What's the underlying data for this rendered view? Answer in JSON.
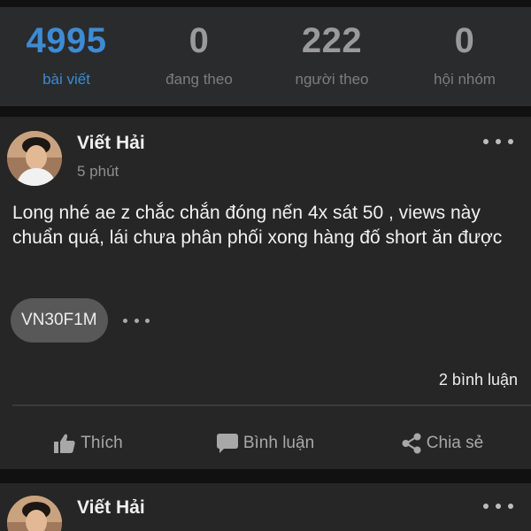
{
  "stats": [
    {
      "value": "4995",
      "label": "bài viết",
      "active": true
    },
    {
      "value": "0",
      "label": "đang theo",
      "active": false
    },
    {
      "value": "222",
      "label": "người theo",
      "active": false
    },
    {
      "value": "0",
      "label": "hội nhóm",
      "active": false
    }
  ],
  "post1": {
    "author": "Viết Hải",
    "time": "5 phút",
    "content": "Long nhé ae z chắc chắn đóng nến 4x sát 50 , views này chuẩn quá, lái chưa phân phối xong hàng đố short ăn được",
    "tag": "VN30F1M",
    "comments": "2 bình luận",
    "actions": {
      "like": "Thích",
      "comment": "Bình luận",
      "share": "Chia sẻ"
    }
  },
  "post2": {
    "author": "Viết Hải"
  },
  "colors": {
    "accent": "#3d8bd4",
    "card": "#262626",
    "background": "#111111",
    "stats_bar": "#2a2b2d",
    "tag": "#585858"
  },
  "icons": {
    "like": "thumbs-up-icon",
    "comment": "speech-bubble-icon",
    "share": "share-icon",
    "more": "more-dots-icon"
  }
}
